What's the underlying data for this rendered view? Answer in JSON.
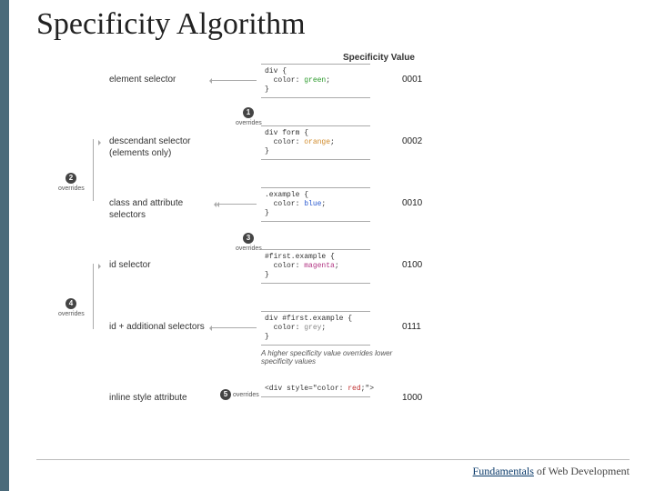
{
  "title": "Specificity Algorithm",
  "spec_header": "Specificity Value",
  "overrides_label": "overrides",
  "note": "A higher specificity value overrides lower specificity values",
  "rows": [
    {
      "label": "element selector",
      "code_pre": "div {\n  color: ",
      "code_color": "green",
      "code_color_class": "g",
      "code_post": ";\n}",
      "value": "0001"
    },
    {
      "label": "descendant selector (elements only)",
      "code_pre": "div form {\n  color: ",
      "code_color": "orange",
      "code_color_class": "kw",
      "code_post": ";\n}",
      "value": "0002"
    },
    {
      "label": "class and attribute selectors",
      "code_pre": ".example {\n  color: ",
      "code_color": "blue",
      "code_color_class": "b",
      "code_post": ";\n}",
      "value": "0010"
    },
    {
      "label": "id selector",
      "code_pre": "#first.example {\n  color: ",
      "code_color": "magenta",
      "code_color_class": "m",
      "code_post": ";\n}",
      "value": "0100"
    },
    {
      "label": "id + additional selectors",
      "code_pre": "div #first.example {\n  color: ",
      "code_color": "grey",
      "code_color_class": "gr",
      "code_post": ";\n}",
      "value": "0111"
    },
    {
      "label": "inline style attribute",
      "code_pre": "<div style=\"color: ",
      "code_color": "red",
      "code_color_class": "r",
      "code_post": ";\">",
      "value": "1000"
    }
  ],
  "footer_underlined": "Fundamentals",
  "footer_rest": " of Web Development"
}
